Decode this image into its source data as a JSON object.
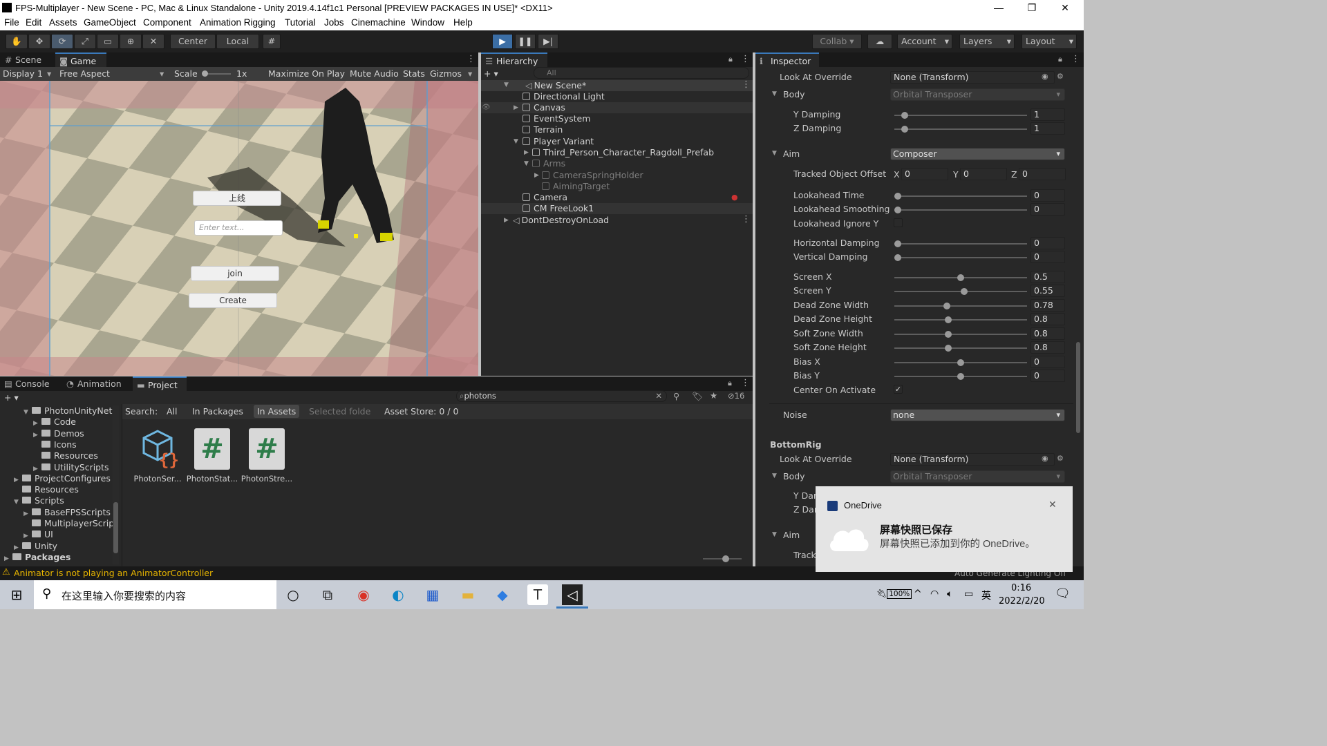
{
  "window": {
    "title": "FPS-Multiplayer - New Scene - PC, Mac & Linux Standalone - Unity 2019.4.14f1c1 Personal [PREVIEW PACKAGES IN USE]* <DX11>",
    "minimize": "—",
    "restore": "❐",
    "close": "✕"
  },
  "menu": [
    "File",
    "Edit",
    "Assets",
    "GameObject",
    "Component",
    "Animation Rigging",
    "Tutorial",
    "Jobs",
    "Cinemachine",
    "Window",
    "Help"
  ],
  "toolbar": {
    "pivot": "Center",
    "space": "Local",
    "collab": "Collab",
    "account": "Account",
    "layers": "Layers",
    "layout": "Layout"
  },
  "scene_panel": {
    "tab_scene": "Scene",
    "tab_game": "Game",
    "display": "Display 1",
    "aspect": "Free Aspect",
    "scale_label": "Scale",
    "scale_value": "1x",
    "maximize": "Maximize On Play",
    "mute": "Mute Audio",
    "stats": "Stats",
    "gizmos": "Gizmos"
  },
  "game_ui": {
    "btn_online": "上线",
    "input_placeholder": "Enter text...",
    "btn_join": "join",
    "btn_create": "Create"
  },
  "hierarchy": {
    "tab": "Hierarchy",
    "search_placeholder": "All",
    "scene": "New Scene*",
    "items": [
      "Directional Light",
      "Canvas",
      "EventSystem",
      "Terrain",
      "Player Variant",
      "Third_Person_Character_Ragdoll_Prefab",
      "Arms",
      "CameraSpringHolder",
      "AimingTarget",
      "Camera",
      "CM FreeLook1",
      "DontDestroyOnLoad"
    ]
  },
  "inspector": {
    "tab": "Inspector",
    "look_at_override": "Look At Override",
    "look_at_value": "None (Transform)",
    "body": "Body",
    "body_value": "Orbital Transposer",
    "y_damping": "Y Damping",
    "y_damping_value": "1",
    "z_damping": "Z Damping",
    "z_damping_value": "1",
    "aim": "Aim",
    "aim_value": "Composer",
    "tracked_offset": "Tracked Object Offset",
    "x": "X",
    "y": "Y",
    "z": "Z",
    "x_val": "0",
    "y_val": "0",
    "z_val": "0",
    "rows": [
      {
        "label": "Lookahead Time",
        "value": "0",
        "pos": 0
      },
      {
        "label": "Lookahead Smoothing",
        "value": "0",
        "pos": 0
      }
    ],
    "lookahead_ignore_y": "Lookahead Ignore Y",
    "rows2": [
      {
        "label": "Horizontal Damping",
        "value": "0",
        "pos": 0
      },
      {
        "label": "Vertical Damping",
        "value": "0",
        "pos": 0
      }
    ],
    "rows3": [
      {
        "label": "Screen X",
        "value": "0.5",
        "pos": 0.5
      },
      {
        "label": "Screen Y",
        "value": "0.55",
        "pos": 0.53
      },
      {
        "label": "Dead Zone Width",
        "value": "0.78",
        "pos": 0.39
      },
      {
        "label": "Dead Zone Height",
        "value": "0.8",
        "pos": 0.4
      },
      {
        "label": "Soft Zone Width",
        "value": "0.8",
        "pos": 0.4
      },
      {
        "label": "Soft Zone Height",
        "value": "0.8",
        "pos": 0.4
      },
      {
        "label": "Bias X",
        "value": "0",
        "pos": 0.5
      },
      {
        "label": "Bias Y",
        "value": "0",
        "pos": 0.5
      }
    ],
    "center_on_activate": "Center On Activate",
    "center_check": "✓",
    "noise": "Noise",
    "noise_value": "none",
    "bottom_rig": "BottomRig",
    "look_at_override2": "Look At Override",
    "look_at_value2": "None (Transform)",
    "body2": "Body",
    "body_value2": "Orbital Transposer",
    "y_dar": "Y Dar",
    "z_dar": "Z Dar",
    "aim2": "Aim",
    "track": "Track",
    "auto_lighting": "Auto Generate Lighting Off"
  },
  "bottom": {
    "tab_console": "Console",
    "tab_animation": "Animation",
    "tab_project": "Project",
    "search_value": "photons",
    "hidden_count": "16",
    "search_label": "Search:",
    "scope_all": "All",
    "scope_packages": "In Packages",
    "scope_assets": "In Assets",
    "scope_selected": "Selected folde",
    "asset_store": "Asset Store: 0 / 0",
    "tree": [
      {
        "label": "PhotonUnityNetv",
        "depth": 2,
        "arrow": "▼"
      },
      {
        "label": "Code",
        "depth": 3,
        "arrow": "▶"
      },
      {
        "label": "Demos",
        "depth": 3,
        "arrow": "▶"
      },
      {
        "label": "Icons",
        "depth": 3,
        "arrow": ""
      },
      {
        "label": "Resources",
        "depth": 3,
        "arrow": ""
      },
      {
        "label": "UtilityScripts",
        "depth": 3,
        "arrow": "▶"
      },
      {
        "label": "ProjectConfigures",
        "depth": 1,
        "arrow": "▶"
      },
      {
        "label": "Resources",
        "depth": 1,
        "arrow": ""
      },
      {
        "label": "Scripts",
        "depth": 1,
        "arrow": "▼"
      },
      {
        "label": "BaseFPSScripts",
        "depth": 2,
        "arrow": "▶"
      },
      {
        "label": "MultiplayerScrip",
        "depth": 2,
        "arrow": ""
      },
      {
        "label": "UI",
        "depth": 2,
        "arrow": "▶"
      },
      {
        "label": "Unity",
        "depth": 1,
        "arrow": "▶"
      },
      {
        "label": "Packages",
        "depth": 0,
        "arrow": "▶"
      }
    ],
    "assets": [
      {
        "name": "PhotonSer..."
      },
      {
        "name": "PhotonStat..."
      },
      {
        "name": "PhotonStre..."
      }
    ]
  },
  "status": {
    "warning": "Animator is not playing an AnimatorController"
  },
  "notification": {
    "app": "OneDrive",
    "title": "屏幕快照已保存",
    "body": "屏幕快照已添加到你的 OneDrive。",
    "close": "✕"
  },
  "taskbar": {
    "search_placeholder": "在这里输入你要搜索的内容",
    "battery": "100%",
    "ime": "英",
    "time": "0:16",
    "date": "2022/2/20"
  },
  "colors": {
    "accent": "#3a79bb",
    "play_active": "#3b6ea5",
    "warning": "#e6b400"
  }
}
